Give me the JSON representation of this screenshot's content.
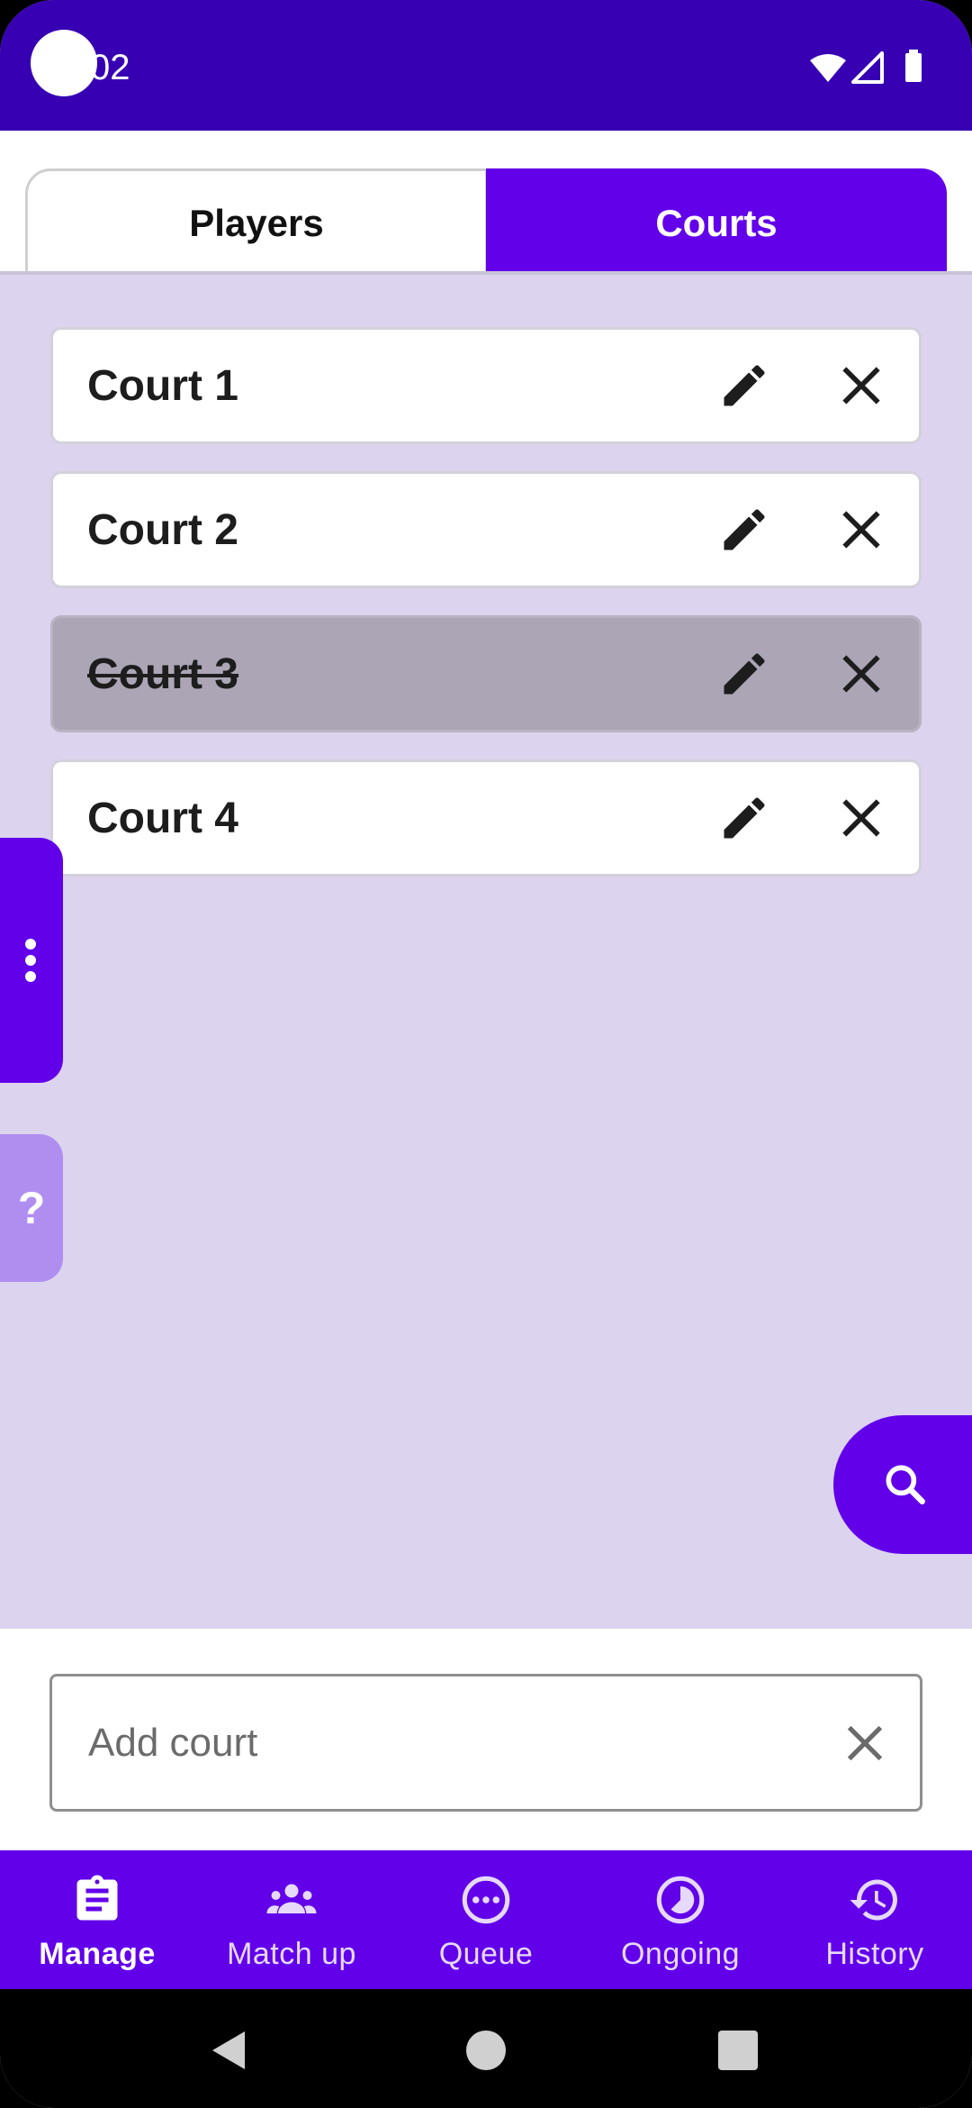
{
  "status_bar": {
    "time": "02"
  },
  "tabs": [
    {
      "label": "Players",
      "active": false
    },
    {
      "label": "Courts",
      "active": true
    }
  ],
  "courts": [
    {
      "name": "Court 1",
      "disabled": false
    },
    {
      "name": "Court 2",
      "disabled": false
    },
    {
      "name": "Court 3",
      "disabled": true
    },
    {
      "name": "Court 4",
      "disabled": false
    }
  ],
  "side_help": {
    "label": "?"
  },
  "add_court": {
    "placeholder": "Add court",
    "value": ""
  },
  "bottom_nav": [
    {
      "label": "Manage",
      "icon": "clipboard-icon",
      "active": true
    },
    {
      "label": "Match up",
      "icon": "group-icon",
      "active": false
    },
    {
      "label": "Queue",
      "icon": "more-circle-icon",
      "active": false
    },
    {
      "label": "Ongoing",
      "icon": "timelapse-icon",
      "active": false
    },
    {
      "label": "History",
      "icon": "history-icon",
      "active": false
    }
  ],
  "colors": {
    "primary": "#6200ea",
    "status_bar": "#3700b3",
    "background": "#dcd3ee",
    "disabled_card": "#aba5b5"
  }
}
